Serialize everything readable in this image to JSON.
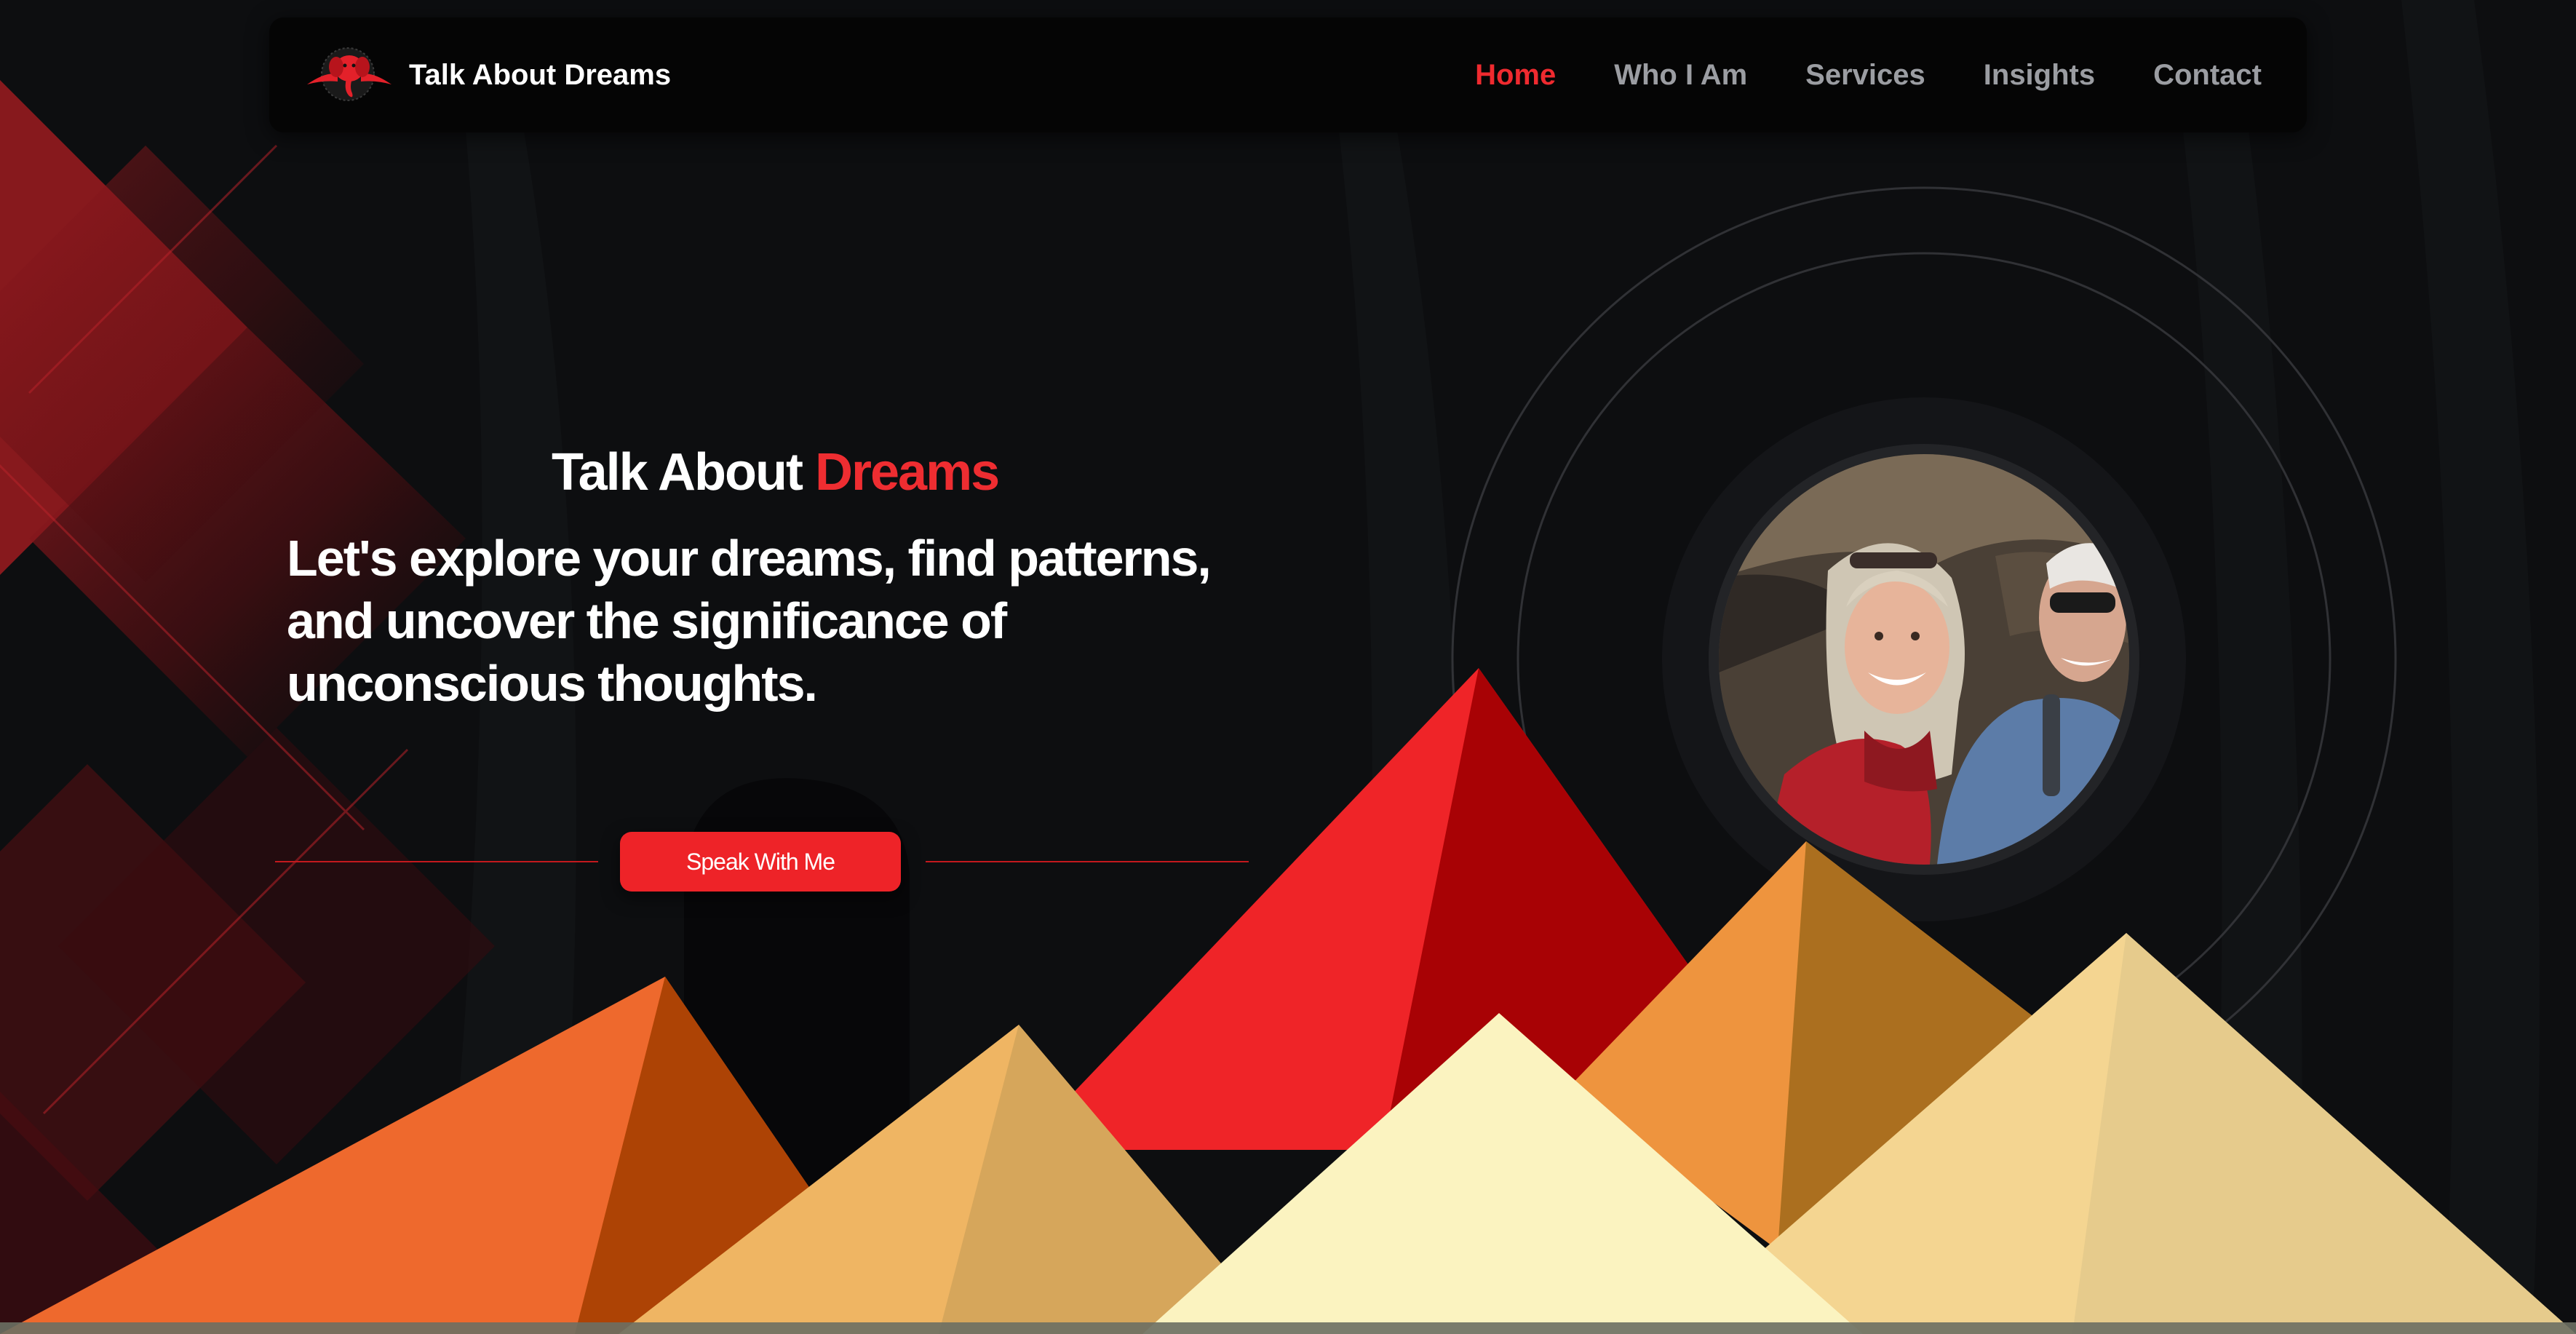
{
  "brand": {
    "name": "Talk About Dreams",
    "logo_icon": "red-elephant-logo-icon"
  },
  "nav": {
    "items": [
      {
        "label": "Home",
        "active": true
      },
      {
        "label": "Who I Am",
        "active": false
      },
      {
        "label": "Services",
        "active": false
      },
      {
        "label": "Insights",
        "active": false
      },
      {
        "label": "Contact",
        "active": false
      }
    ]
  },
  "hero": {
    "title_main": "Talk About",
    "title_accent": "Dreams",
    "tagline": "Let's explore your dreams, find patterns, and uncover the significance of unconscious thoughts.",
    "cta_label": "Speak With Me"
  },
  "colors": {
    "background": "#0d0e10",
    "accent": "#ee2328",
    "nav_inactive": "#9b9da2",
    "pyramid_orange": "#ee6a2c",
    "pyramid_red": "#ee2328",
    "pyramid_tan": "#efb563",
    "pyramid_cream": "#fbf3c0",
    "pyramid_gold": "#f6d590"
  }
}
